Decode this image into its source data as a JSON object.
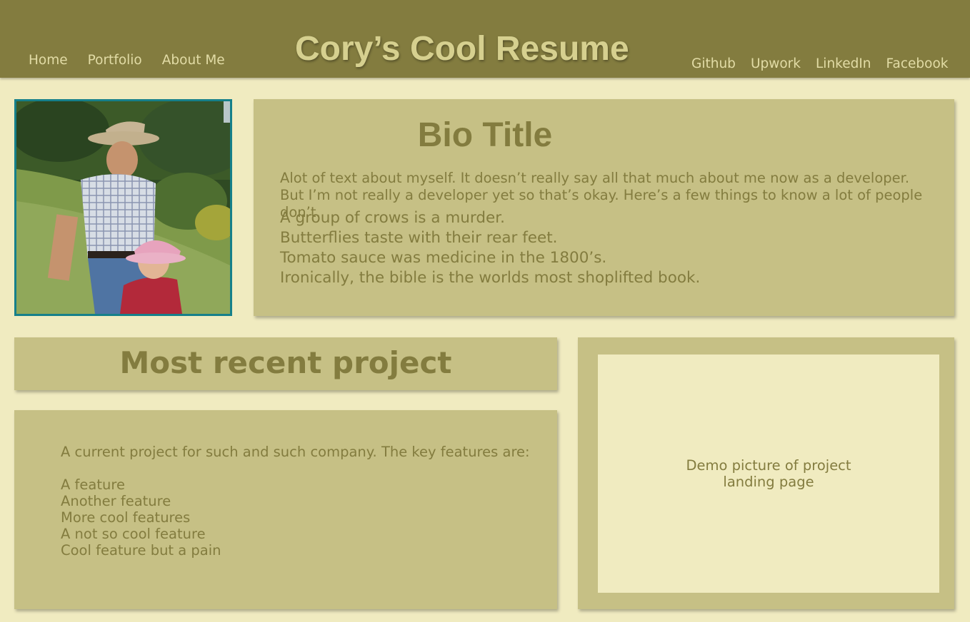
{
  "header": {
    "title": "Cory’s Cool Resume",
    "nav_left": [
      "Home",
      "Portfolio",
      "About Me"
    ],
    "nav_right": [
      "Github",
      "Upwork",
      "LinkedIn",
      "Facebook"
    ]
  },
  "bio": {
    "photo_icon": "profile-photo",
    "title": "Bio Title",
    "intro": "Alot of text about myself. It doesn’t really say all that much about me now as a developer. But I’m not really a developer yet so that’s okay. Here’s a few things to know a lot of people don’t.",
    "facts": [
      "A group of crows is a murder.",
      "Butterflies taste with their rear feet.",
      "Tomato sauce was medicine in the 1800’s.",
      "Ironically, the bible is the worlds most shoplifted book."
    ]
  },
  "project": {
    "heading": "Most recent project",
    "description": "A current project for such and such company. The key features are:",
    "features": [
      "A feature",
      "Another feature",
      "More cool features",
      "A not so cool feature",
      "Cool feature but a pain"
    ],
    "demo_caption": "Demo picture of project landing page"
  },
  "colors": {
    "header_bg": "#837c3f",
    "page_bg": "#f0ebc0",
    "card_bg": "#c6c085",
    "text": "#837c3f",
    "nav_text": "#e2dca6",
    "photo_border": "#16808a"
  }
}
